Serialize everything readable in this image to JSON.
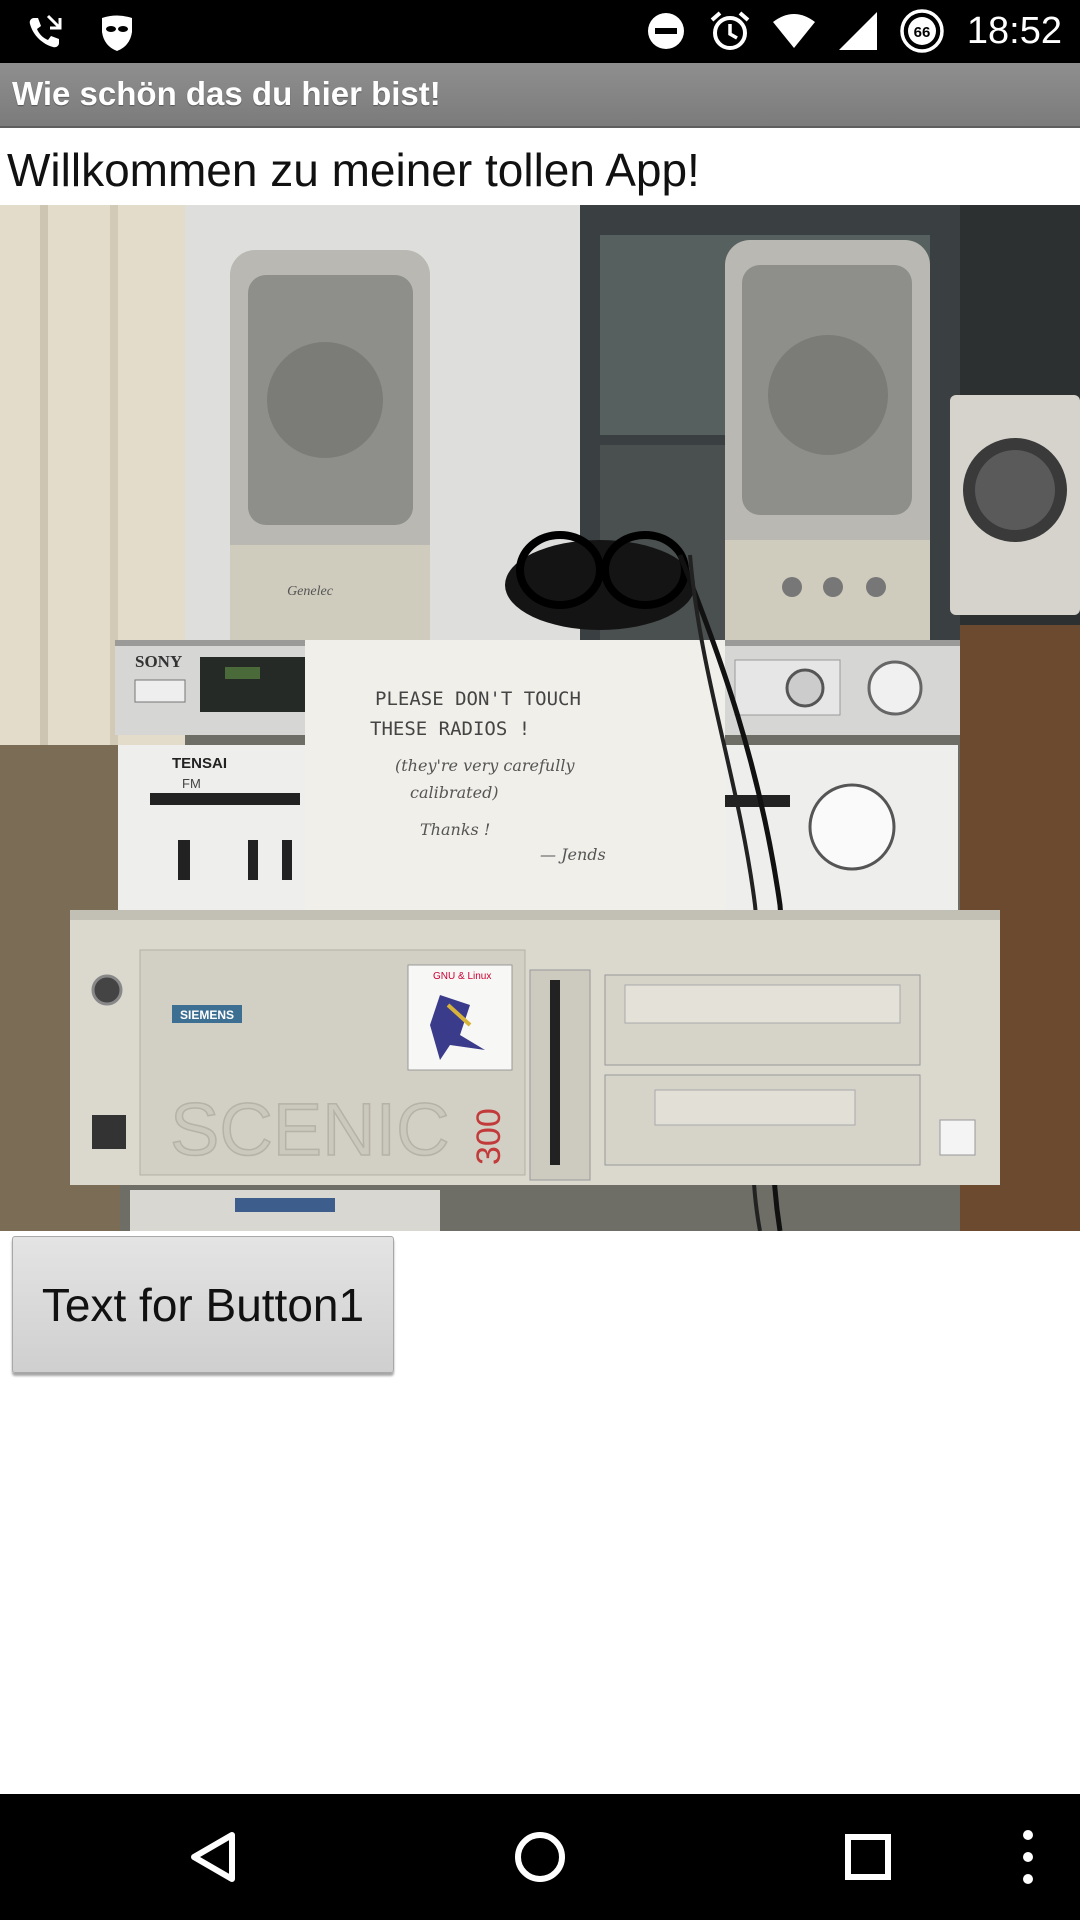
{
  "status_bar": {
    "time": "18:52",
    "battery_level": "66",
    "icons": [
      "missed-call-icon",
      "privacy-mask-icon",
      "do-not-disturb-icon",
      "alarm-icon",
      "wifi-icon",
      "signal-icon",
      "battery-icon"
    ]
  },
  "app": {
    "title": "Wie schön das du hier bist!",
    "welcome_text": "Willkommen zu meiner tollen App!",
    "button_label": "Text for Button1"
  },
  "photo": {
    "sony_label": "SONY",
    "tensai_label": "TENSAI",
    "fm_label": "FM",
    "speaker_brand": "Genelec",
    "note_lines": [
      "PLEASE DON'T TOUCH",
      "THESE RADIOS !",
      "(they're very carefully",
      "calibrated)",
      "Thanks !",
      "— Jends"
    ],
    "siemens_label": "SIEMENS",
    "scenic_label": "SCENIC",
    "model_number": "300",
    "sticker_text": "GNU & Linux"
  },
  "navigation_bar": {
    "icons": [
      "back-icon",
      "home-icon",
      "recents-icon",
      "overflow-menu-icon"
    ]
  },
  "colors": {
    "status_bar": "#000000",
    "title_bar": "#858585",
    "background": "#ffffff",
    "button": "#dcdcdc"
  }
}
